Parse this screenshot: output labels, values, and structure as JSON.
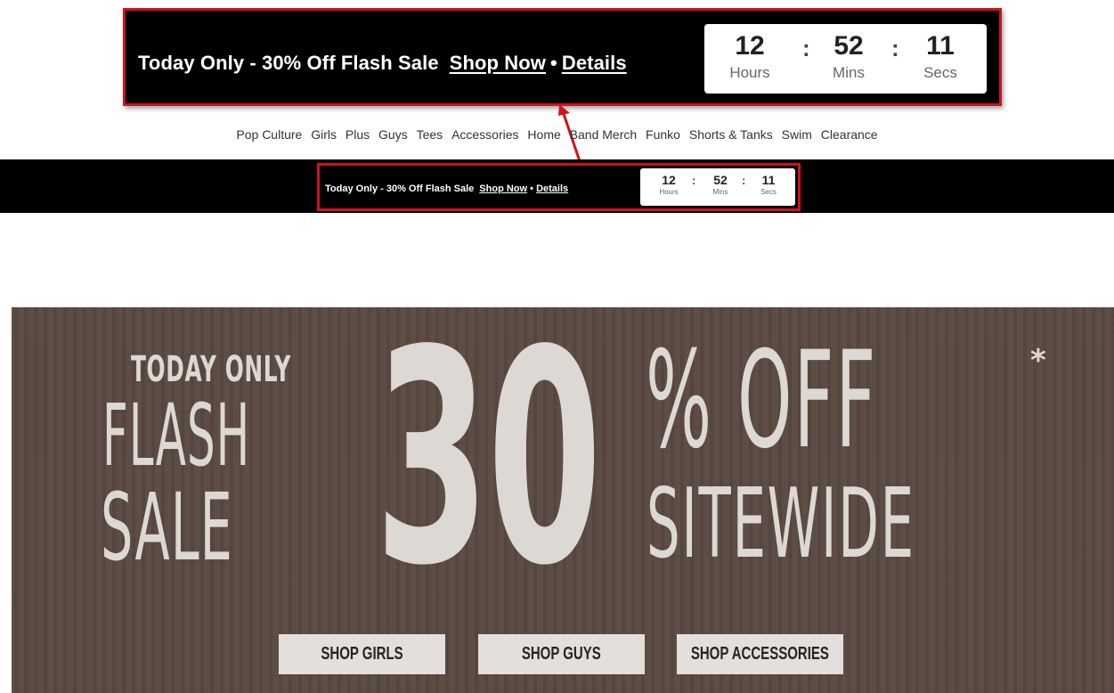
{
  "promo": {
    "text": "Today Only - 30% Off Flash Sale",
    "shop_now": "Shop Now",
    "separator": "•",
    "details": "Details"
  },
  "timer": {
    "hours": "12",
    "hours_label": "Hours",
    "mins": "52",
    "mins_label": "Mins",
    "secs": "11",
    "secs_label": "Secs",
    "colon": ":"
  },
  "nav": {
    "items": [
      "Pop Culture",
      "Girls",
      "Plus",
      "Guys",
      "Tees",
      "Accessories",
      "Home",
      "Band Merch",
      "Funko",
      "Shorts & Tanks",
      "Swim",
      "Clearance"
    ]
  },
  "hero": {
    "today_only": "TODAY ONLY",
    "flash": "FLASH",
    "sale": "SALE",
    "big_number": "30",
    "off": "% OFF",
    "asterisk": "*",
    "sitewide": "SITEWIDE",
    "buttons": [
      "SHOP GIRLS",
      "SHOP GUYS",
      "SHOP ACCESSORIES"
    ]
  },
  "colors": {
    "callout_border": "#d0121b",
    "bar_bg": "#000000",
    "hero_bg": "#5a4a42",
    "hero_text": "#dcd8d4"
  }
}
